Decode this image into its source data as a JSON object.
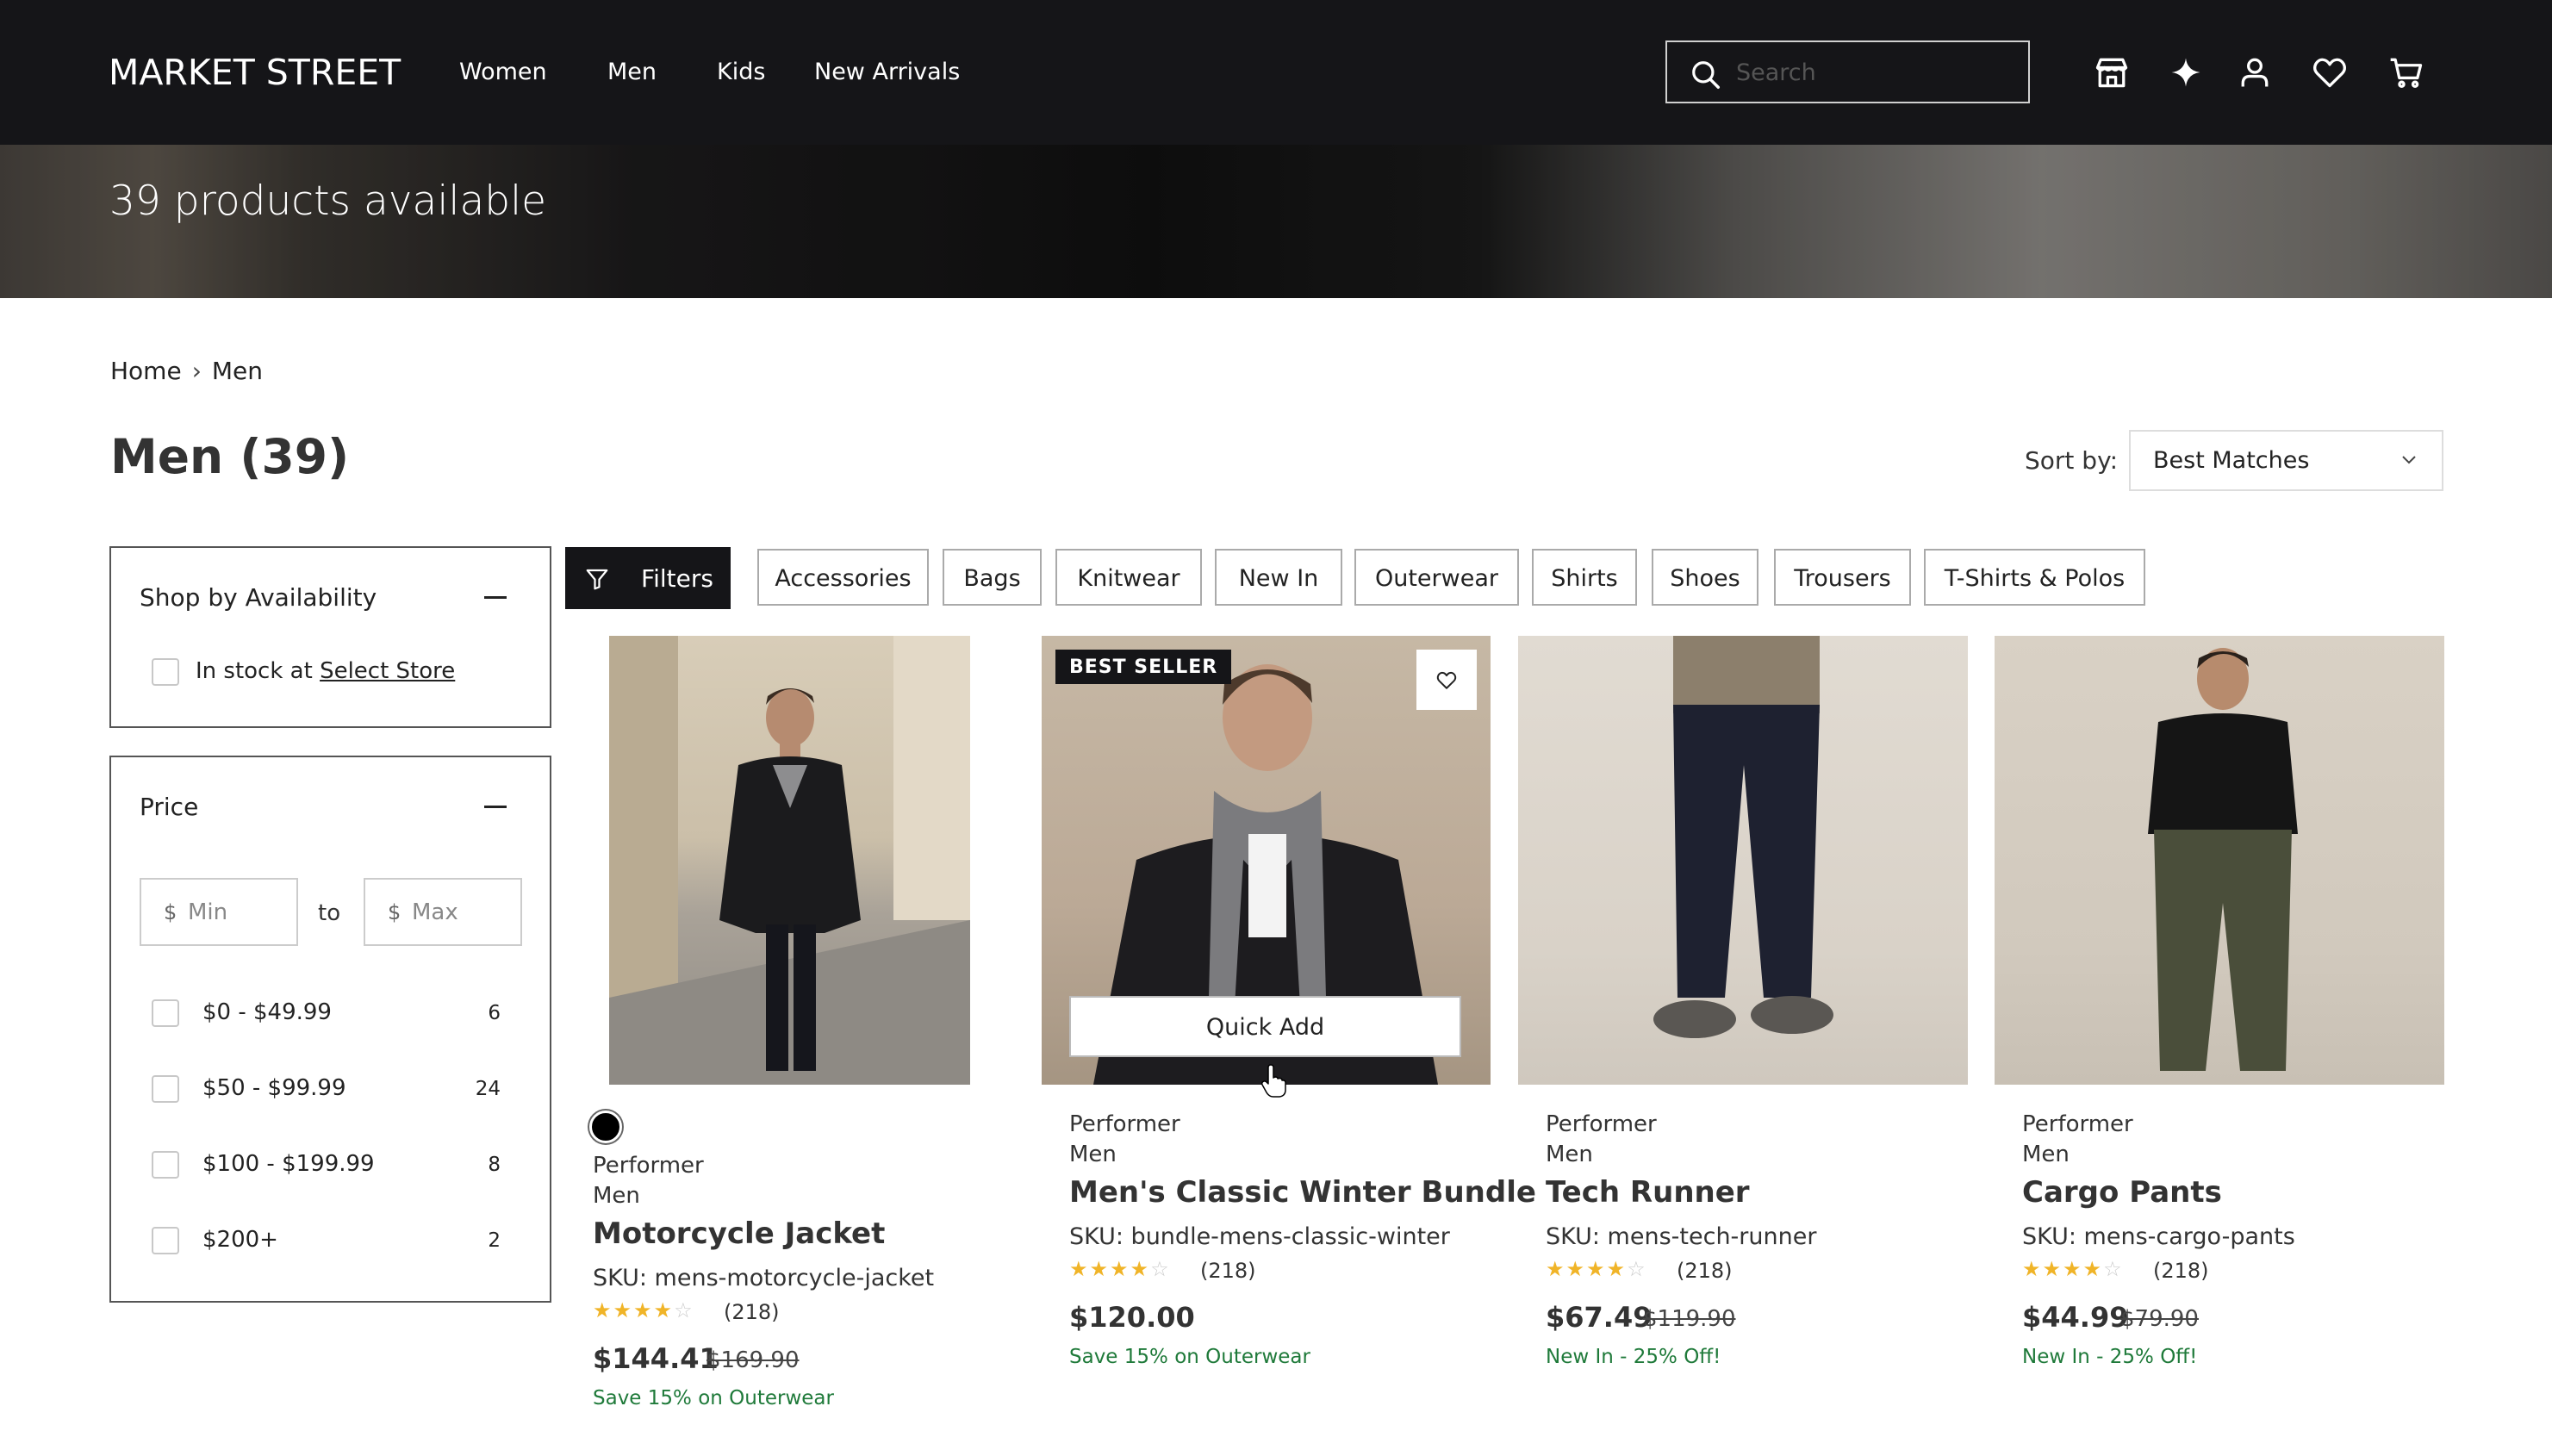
{
  "header": {
    "logo": "MARKET STREET",
    "nav": [
      "Women",
      "Men",
      "Kids",
      "New Arrivals"
    ],
    "search_placeholder": "Search",
    "icons": [
      "store-icon",
      "sparkle-icon",
      "account-icon",
      "wishlist-icon",
      "cart-icon"
    ]
  },
  "hero": {
    "text": "39 products available"
  },
  "breadcrumb": [
    "Home",
    "Men"
  ],
  "page_title": "Men (39)",
  "sort": {
    "label": "Sort by:",
    "value": "Best Matches"
  },
  "sidebar": {
    "availability": {
      "title": "Shop by Availability",
      "option_text": "In stock at",
      "option_link": "Select Store"
    },
    "price": {
      "title": "Price",
      "currency": "$",
      "min_placeholder": "Min",
      "max_placeholder": "Max",
      "to": "to",
      "ranges": [
        {
          "label": "$0 - $49.99",
          "count": "6"
        },
        {
          "label": "$50 - $99.99",
          "count": "24"
        },
        {
          "label": "$100 - $199.99",
          "count": "8"
        },
        {
          "label": "$200+",
          "count": "2"
        }
      ]
    }
  },
  "filters": {
    "button": "Filters",
    "chips": [
      "Accessories",
      "Bags",
      "Knitwear",
      "New In",
      "Outerwear",
      "Shirts",
      "Shoes",
      "Trousers",
      "T-Shirts & Polos"
    ]
  },
  "products": [
    {
      "brand": "Performer",
      "category": "Men",
      "name": "Motorcycle Jacket",
      "sku": "SKU: mens-motorcycle-jacket",
      "rating": 4,
      "reviews": "(218)",
      "price": "$144.41",
      "was": "$169.90",
      "promo": "Save 15% on Outerwear",
      "swatch_color": "#000000"
    },
    {
      "brand": "Performer",
      "category": "Men",
      "name": "Men's Classic Winter Bundle",
      "sku": "SKU: bundle-mens-classic-winter",
      "rating": 4,
      "reviews": "(218)",
      "price": "$120.00",
      "was": "",
      "promo": "Save 15% on Outerwear",
      "badge": "BEST SELLER",
      "quick_add": "Quick Add"
    },
    {
      "brand": "Performer",
      "category": "Men",
      "name": "Tech Runner",
      "sku": "SKU: mens-tech-runner",
      "rating": 4,
      "reviews": "(218)",
      "price": "$67.49",
      "was": "$119.90",
      "promo": "New In - 25% Off!"
    },
    {
      "brand": "Performer",
      "category": "Men",
      "name": "Cargo Pants",
      "sku": "SKU: mens-cargo-pants",
      "rating": 4,
      "reviews": "(218)",
      "price": "$44.99",
      "was": "$79.90",
      "promo": "New In - 25% Off!"
    }
  ],
  "colors": {
    "header_bg": "#151518",
    "promo_green": "#1f7a3a",
    "star": "#f0b428"
  }
}
